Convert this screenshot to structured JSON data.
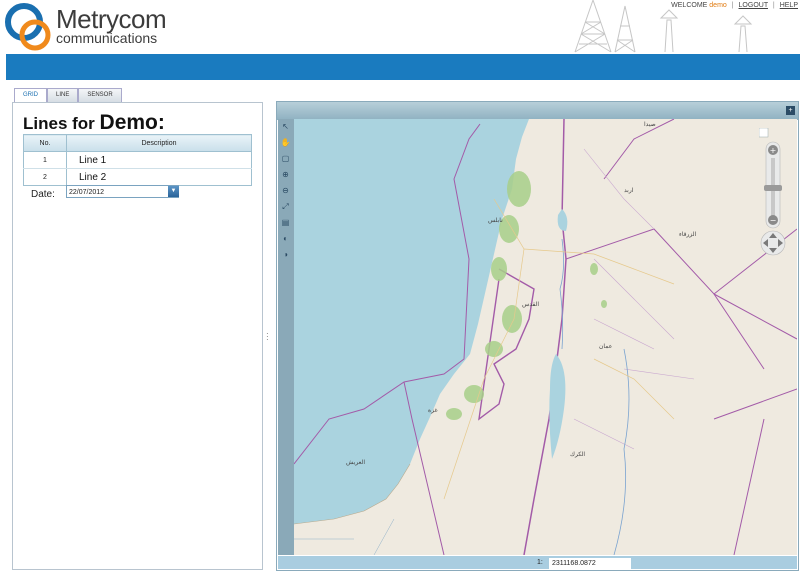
{
  "brand": {
    "name": "Metrycom",
    "tagline": "communications"
  },
  "header_links": {
    "welcome": "WELCOME",
    "user": "demo",
    "logout": "LOGOUT",
    "help": "HELP",
    "sep": "|"
  },
  "tabs": [
    {
      "label": "GRID",
      "active": true
    },
    {
      "label": "LINE",
      "active": false
    },
    {
      "label": "SENSOR",
      "active": false
    }
  ],
  "panel": {
    "title_prefix": "Lines for",
    "title_name": "Demo:",
    "columns": {
      "no": "No.",
      "description": "Description"
    },
    "rows": [
      {
        "no": "1",
        "description": "Line 1"
      },
      {
        "no": "2",
        "description": "Line 2"
      }
    ],
    "date_label": "Date:",
    "date_value": "22/07/2012"
  },
  "map": {
    "scale_prefix": "1:",
    "scale_value": "2311168.0872",
    "labels": [
      "عمان",
      "الكرك",
      "القدس",
      "اربد",
      "غزة",
      "نابلس",
      "الزرقاء",
      "صيدا",
      "العريش"
    ]
  },
  "colors": {
    "accent_blue": "#1a7bbf",
    "logo_blue": "#1a6fb0",
    "logo_orange": "#f08a1c",
    "sea": "#aad3df"
  },
  "icons": [
    "logo-rings-icon",
    "tower-icon",
    "pointer-icon",
    "pan-icon",
    "zoom-box-icon",
    "zoom-in-icon",
    "zoom-out-icon",
    "extent-icon",
    "previous-icon",
    "next-icon",
    "calendar-icon",
    "maximize-icon"
  ]
}
